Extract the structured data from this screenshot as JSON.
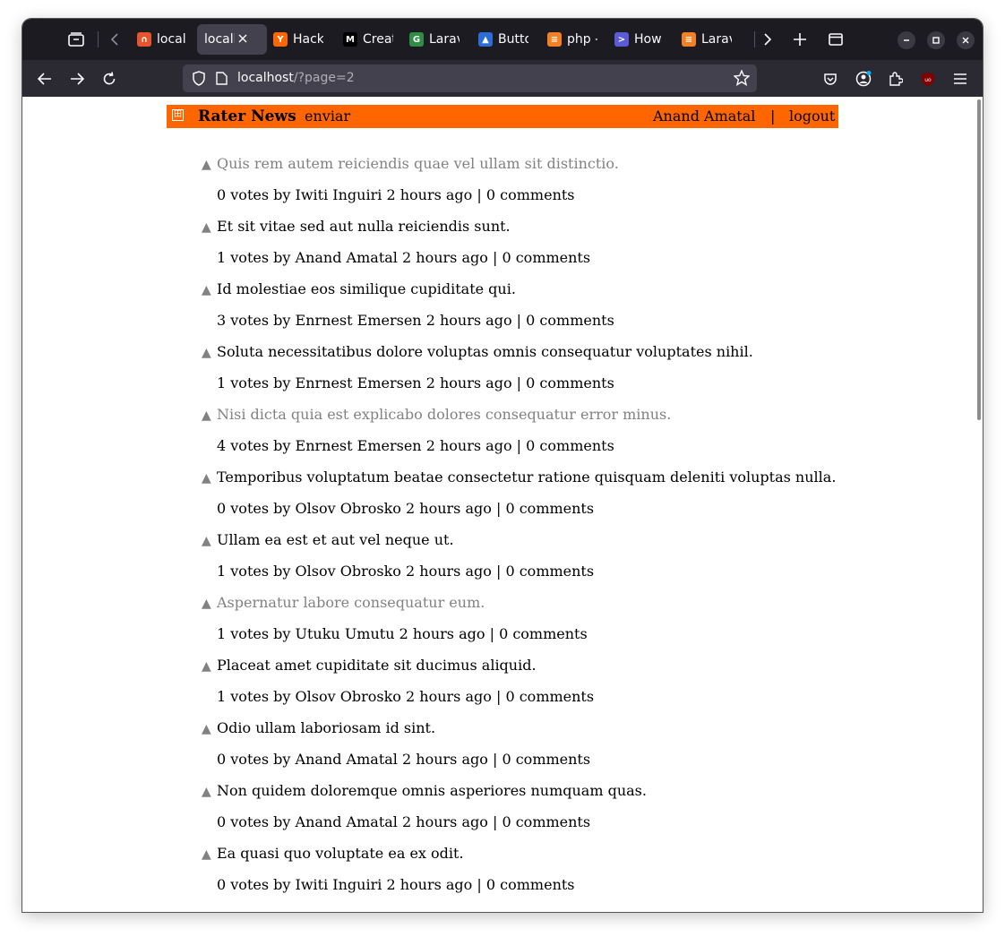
{
  "browser": {
    "tabs": [
      {
        "title": "local",
        "fav_color": "#e8552d",
        "fav_glyph": "∩",
        "active": false
      },
      {
        "title": "localh",
        "fav_color": "",
        "fav_glyph": "",
        "active": true
      },
      {
        "title": "Hack",
        "fav_color": "#ff6600",
        "fav_glyph": "Y",
        "active": false
      },
      {
        "title": "Creat",
        "fav_color": "#000000",
        "fav_glyph": "M",
        "active": false
      },
      {
        "title": "Larav",
        "fav_color": "#2f8d46",
        "fav_glyph": "G",
        "active": false
      },
      {
        "title": "Butto",
        "fav_color": "#2d6dd6",
        "fav_glyph": "▲",
        "active": false
      },
      {
        "title": "php -",
        "fav_color": "#f48024",
        "fav_glyph": "≡",
        "active": false
      },
      {
        "title": "How",
        "fav_color": "#5b5bd6",
        "fav_glyph": ">",
        "active": false
      },
      {
        "title": "Larav",
        "fav_color": "#f48024",
        "fav_glyph": "≡",
        "active": false
      }
    ],
    "url_host": "localhost",
    "url_path": "/?page=2"
  },
  "site": {
    "brand": "Rater News",
    "submit": "enviar",
    "user": "Anand Amatal",
    "separator": "|",
    "logout": "logout",
    "accent": "#ff6600"
  },
  "stories": [
    {
      "title": "Quis rem autem reiciendis quae vel ullam sit distinctio.",
      "visited": true,
      "votes": "0 votes",
      "author": "Iwiti Inguiri",
      "age": "2 hours ago",
      "comments": "0 comments"
    },
    {
      "title": "Et sit vitae sed aut nulla reiciendis sunt.",
      "visited": false,
      "votes": "1 votes",
      "author": "Anand Amatal",
      "age": "2 hours ago",
      "comments": "0 comments"
    },
    {
      "title": "Id molestiae eos similique cupiditate qui.",
      "visited": false,
      "votes": "3 votes",
      "author": "Enrnest Emersen",
      "age": "2 hours ago",
      "comments": "0 comments"
    },
    {
      "title": "Soluta necessitatibus dolore voluptas omnis consequatur voluptates nihil.",
      "visited": false,
      "votes": "1 votes",
      "author": "Enrnest Emersen",
      "age": "2 hours ago",
      "comments": "0 comments"
    },
    {
      "title": "Nisi dicta quia est explicabo dolores consequatur error minus.",
      "visited": true,
      "votes": "4 votes",
      "author": "Enrnest Emersen",
      "age": "2 hours ago",
      "comments": "0 comments"
    },
    {
      "title": "Temporibus voluptatum beatae consectetur ratione quisquam deleniti voluptas nulla.",
      "visited": false,
      "votes": "0 votes",
      "author": "Olsov Obrosko",
      "age": "2 hours ago",
      "comments": "0 comments"
    },
    {
      "title": "Ullam ea est et aut vel neque ut.",
      "visited": false,
      "votes": "1 votes",
      "author": "Olsov Obrosko",
      "age": "2 hours ago",
      "comments": "0 comments"
    },
    {
      "title": "Aspernatur labore consequatur eum.",
      "visited": true,
      "votes": "1 votes",
      "author": "Utuku Umutu",
      "age": "2 hours ago",
      "comments": "0 comments"
    },
    {
      "title": "Placeat amet cupiditate sit ducimus aliquid.",
      "visited": false,
      "votes": "1 votes",
      "author": "Olsov Obrosko",
      "age": "2 hours ago",
      "comments": "0 comments"
    },
    {
      "title": "Odio ullam laboriosam id sint.",
      "visited": false,
      "votes": "0 votes",
      "author": "Anand Amatal",
      "age": "2 hours ago",
      "comments": "0 comments"
    },
    {
      "title": "Non quidem doloremque omnis asperiores numquam quas.",
      "visited": false,
      "votes": "0 votes",
      "author": "Anand Amatal",
      "age": "2 hours ago",
      "comments": "0 comments"
    },
    {
      "title": "Ea quasi quo voluptate ea ex odit.",
      "visited": false,
      "votes": "0 votes",
      "author": "Iwiti Inguiri",
      "age": "2 hours ago",
      "comments": "0 comments"
    }
  ],
  "labels": {
    "by": "by",
    "sep": "|",
    "upvote": "▲"
  }
}
